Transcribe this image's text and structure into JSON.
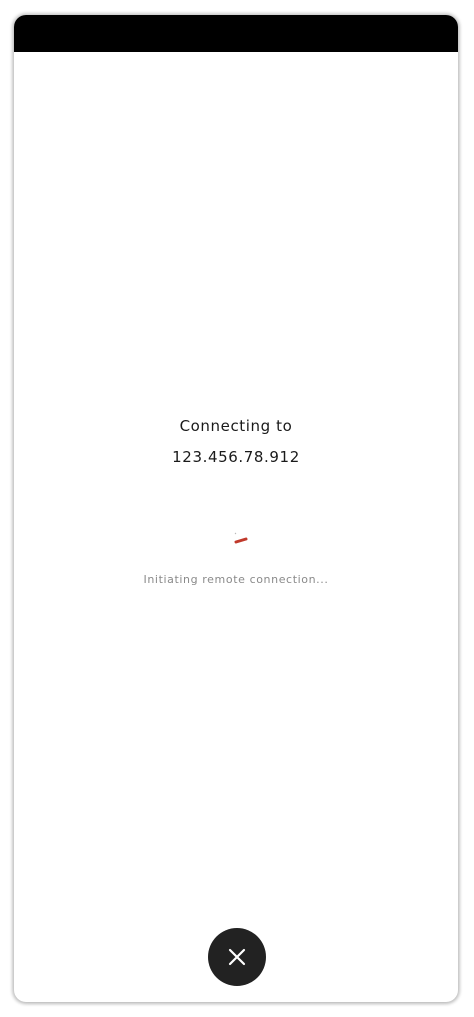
{
  "status_bar": {
    "color": "#000000"
  },
  "connection": {
    "heading": "Connecting to",
    "address": "123.456.78.912",
    "status": "Initiating remote connection..."
  },
  "spinner": {
    "accent_color": "#c0392b"
  },
  "close_button": {
    "icon": "close-icon",
    "background": "#222222"
  }
}
